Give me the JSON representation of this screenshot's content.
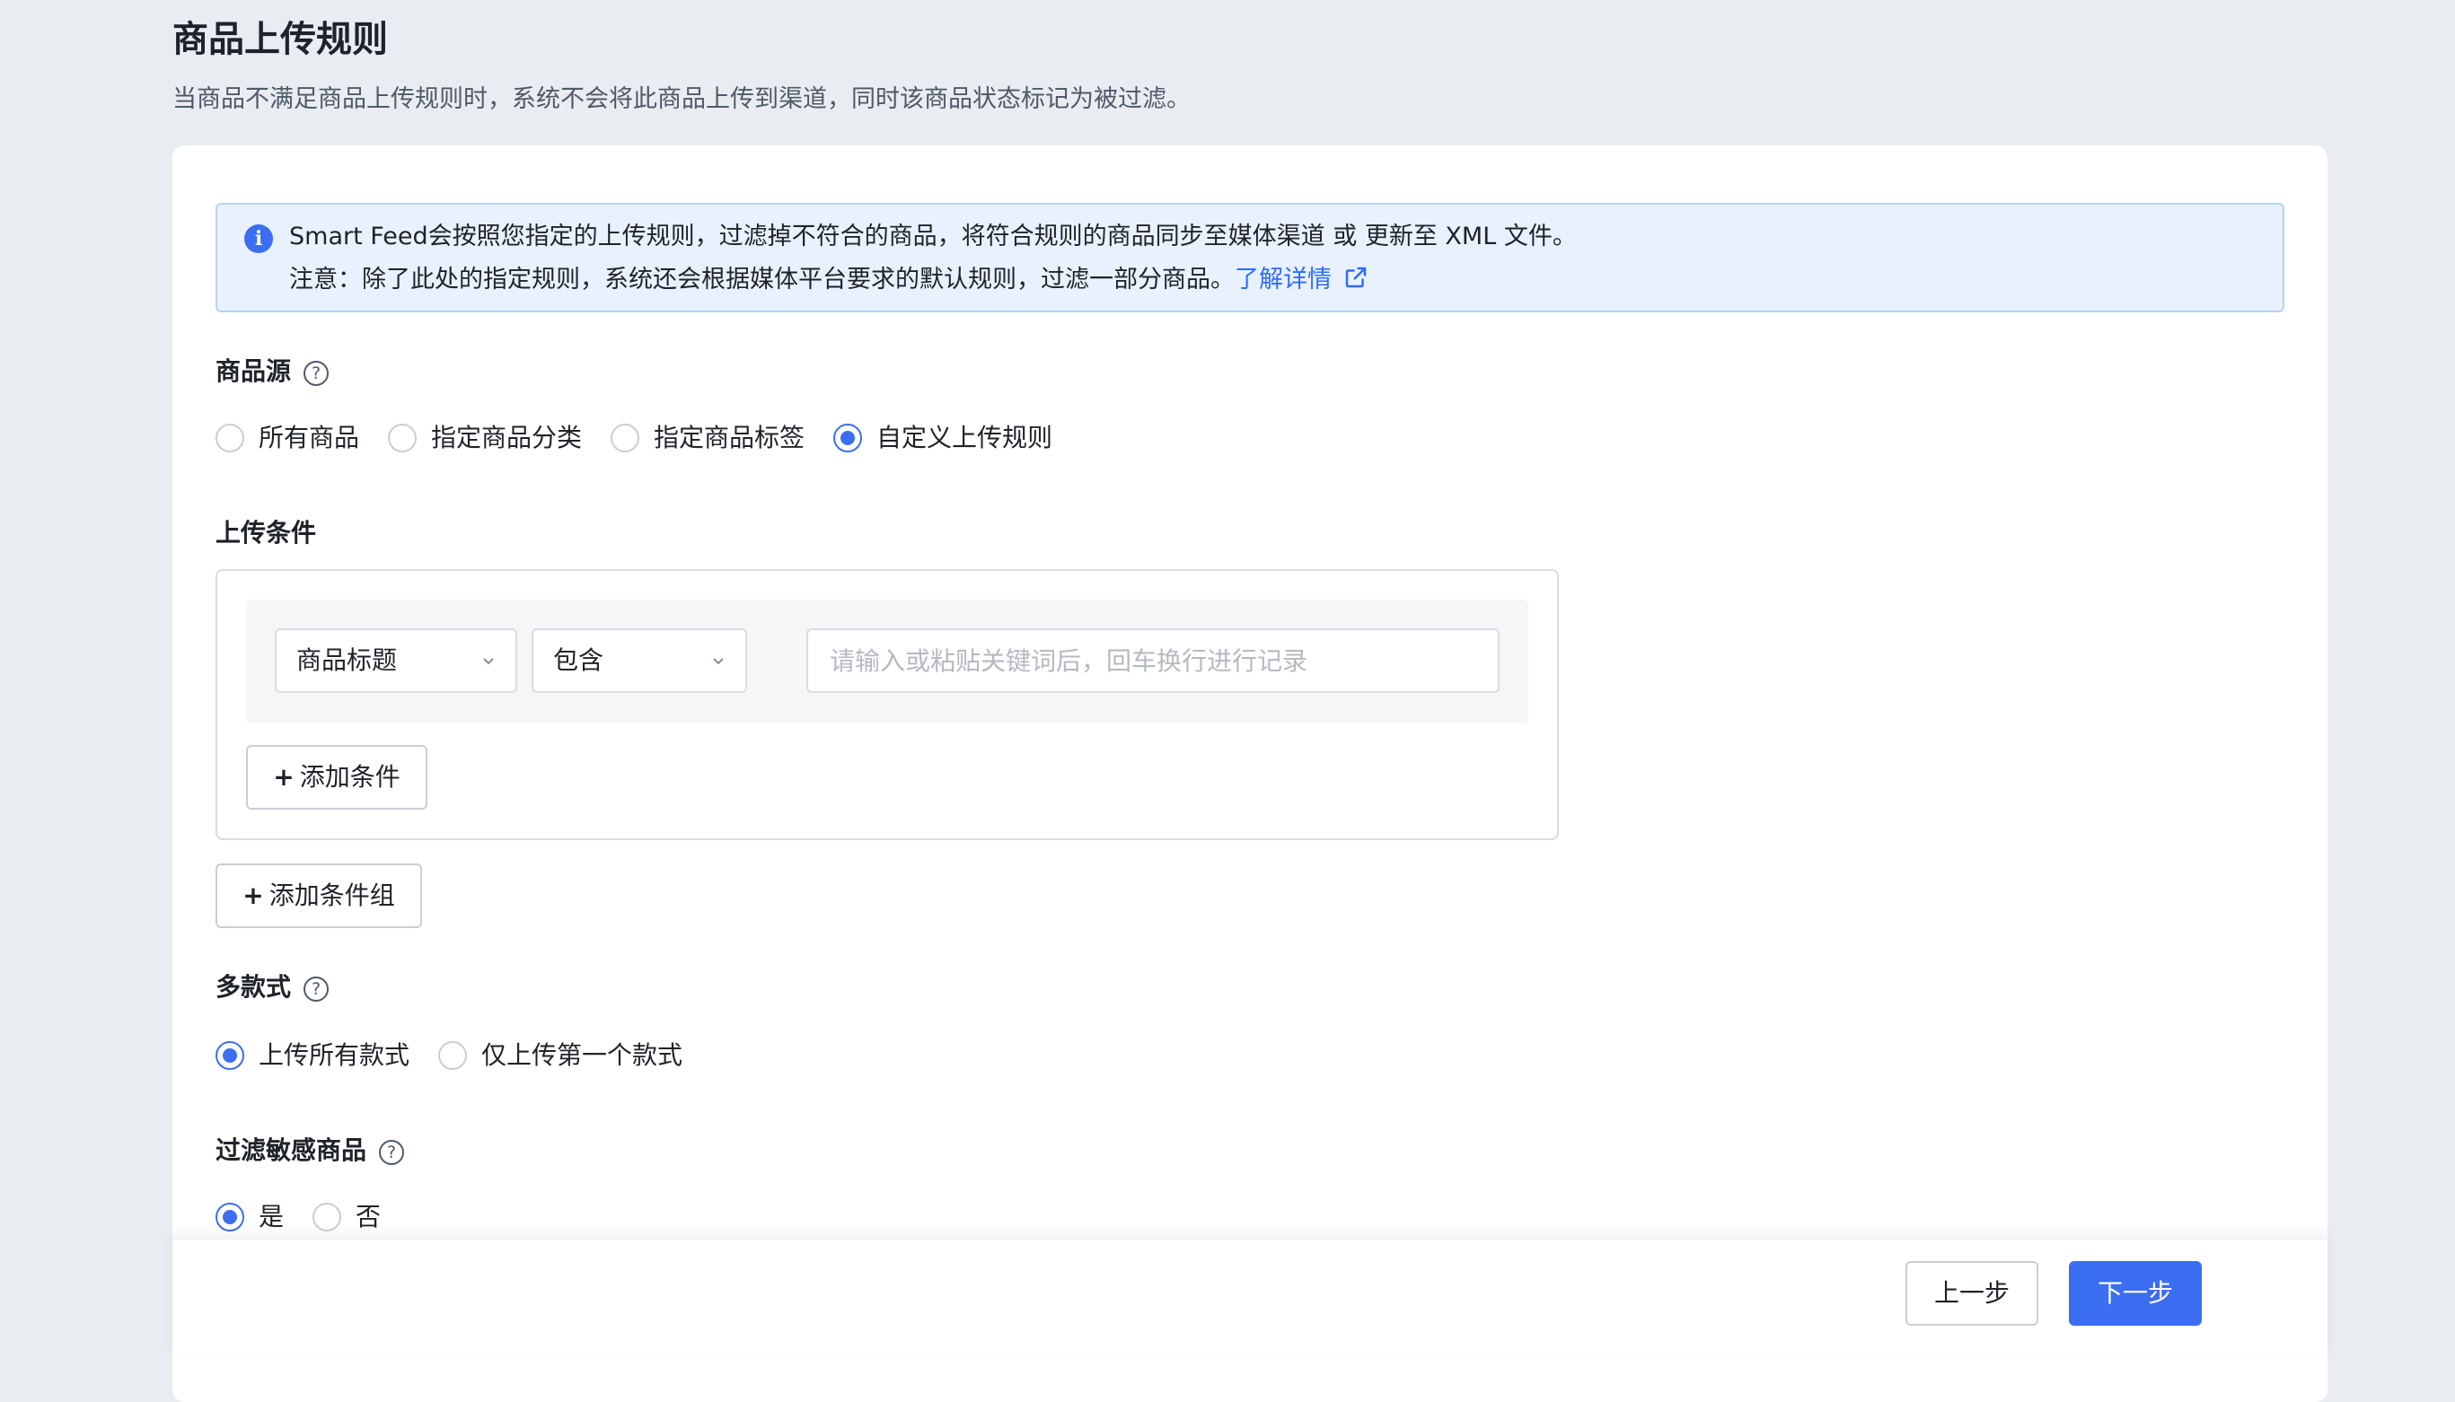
{
  "header": {
    "title": "商品上传规则",
    "description": "当商品不满足商品上传规则时，系统不会将此商品上传到渠道，同时该商品状态标记为被过滤。"
  },
  "notice": {
    "icon": "info-icon",
    "line1": "Smart Feed会按照您指定的上传规则，过滤掉不符合的商品，将符合规则的商品同步至媒体渠道 或 更新至 XML 文件。",
    "line2": "注意：除了此处的指定规则，系统还会根据媒体平台要求的默认规则，过滤一部分商品。",
    "link_label": "了解详情",
    "link_icon": "external-link-icon",
    "bg_color": "#e8f1fd",
    "link_color": "#2f6bff"
  },
  "product_source": {
    "label": "商品源",
    "help_icon": "question-circle-icon",
    "options": [
      "所有商品",
      "指定商品分类",
      "指定商品标签",
      "自定义上传规则"
    ],
    "selected": "自定义上传规则"
  },
  "upload_conditions": {
    "label": "上传条件",
    "field_select": {
      "value": "商品标题"
    },
    "operator_select": {
      "value": "包含"
    },
    "keyword_input": {
      "value": "",
      "placeholder": "请输入或粘贴关键词后，回车换行进行记录"
    },
    "add_condition_label": "添加条件",
    "add_group_label": "添加条件组",
    "plus": "+"
  },
  "multi_variant": {
    "label": "多款式",
    "help_icon": "question-circle-icon",
    "options": [
      "上传所有款式",
      "仅上传第一个款式"
    ],
    "selected": "上传所有款式"
  },
  "sensitive_filter": {
    "label": "过滤敏感商品",
    "help_icon": "question-circle-icon",
    "options": [
      "是",
      "否"
    ],
    "selected": "是"
  },
  "footer": {
    "prev_label": "上一步",
    "next_label": "下一步",
    "primary_color": "#3b6ef0"
  }
}
